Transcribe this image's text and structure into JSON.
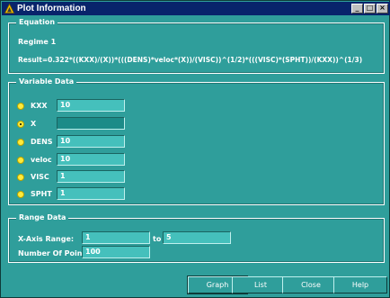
{
  "window": {
    "title": "Plot Information",
    "controls": {
      "minimize": "_",
      "maximize": "□",
      "close": "×"
    }
  },
  "equation": {
    "legend": "Equation",
    "regime": "Regime 1",
    "result": "Result=0.322*((KXX)/(X))*(((DENS)*veloc*(X))/(VISC))^(1/2)*(((VISC)*(SPHT))/(KXX))^(1/3)"
  },
  "variable_data": {
    "legend": "Variable Data",
    "items": [
      {
        "label": "KXX",
        "value": "10",
        "selected": false
      },
      {
        "label": "X",
        "value": "",
        "selected": true
      },
      {
        "label": "DENS",
        "value": "10",
        "selected": false
      },
      {
        "label": "veloc",
        "value": "10",
        "selected": false
      },
      {
        "label": "VISC",
        "value": "1",
        "selected": false
      },
      {
        "label": "SPHT",
        "value": "1",
        "selected": false
      }
    ]
  },
  "range_data": {
    "legend": "Range Data",
    "x_axis_label": "X-Axis Range:",
    "x_min": "1",
    "to_label": "to",
    "x_max": "5",
    "points_label": "Number Of Points:",
    "points": "100"
  },
  "buttons": {
    "graph": "Graph",
    "list": "List",
    "close": "Close",
    "help": "Help"
  },
  "colors": {
    "background": "#2f9e9b",
    "titlebar": "#08246b",
    "field": "#45c0bc",
    "radio": "#ffeb3b"
  }
}
